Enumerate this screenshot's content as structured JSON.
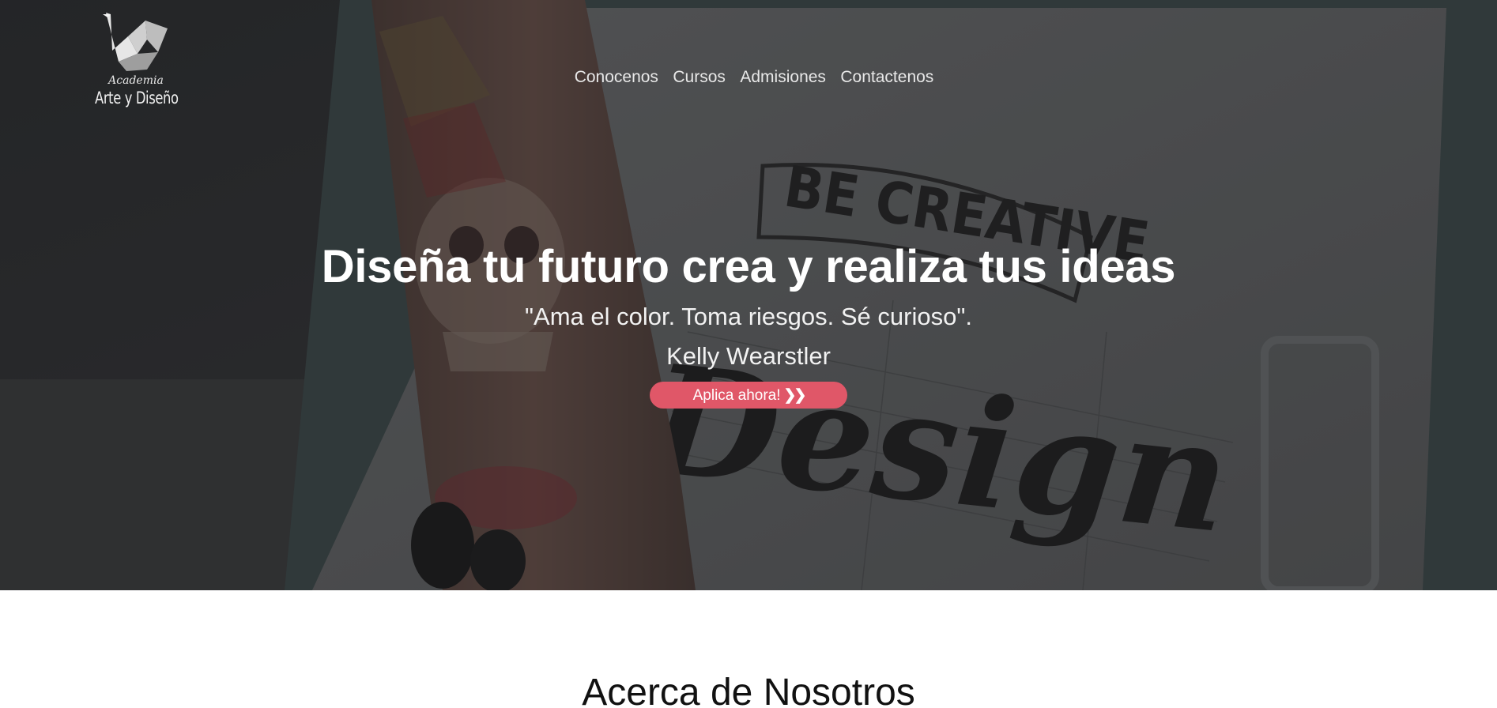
{
  "brand": {
    "small_text": "Academia",
    "big_text": "Arte y Diseño",
    "logo_icon": "origami-swan-icon"
  },
  "nav": {
    "items": [
      "Conocenos",
      "Cursos",
      "Admisiones",
      "Contactenos"
    ]
  },
  "hero": {
    "headline": "Diseña tu futuro crea y realiza tus ideas",
    "quote": "\"Ama el color. Toma riesgos. Sé curioso\".",
    "author": "Kelly Wearstler",
    "cta_label": "Aplica ahora!",
    "cta_icon": "double-chevron-right-icon",
    "background_text_top": "BE CREATIVE",
    "background_text_script": "Design"
  },
  "about": {
    "title": "Acerca de Nosotros"
  },
  "colors": {
    "accent": "#e05768",
    "overlay": "#2b2d2f",
    "text_on_dark": "#ffffff"
  }
}
